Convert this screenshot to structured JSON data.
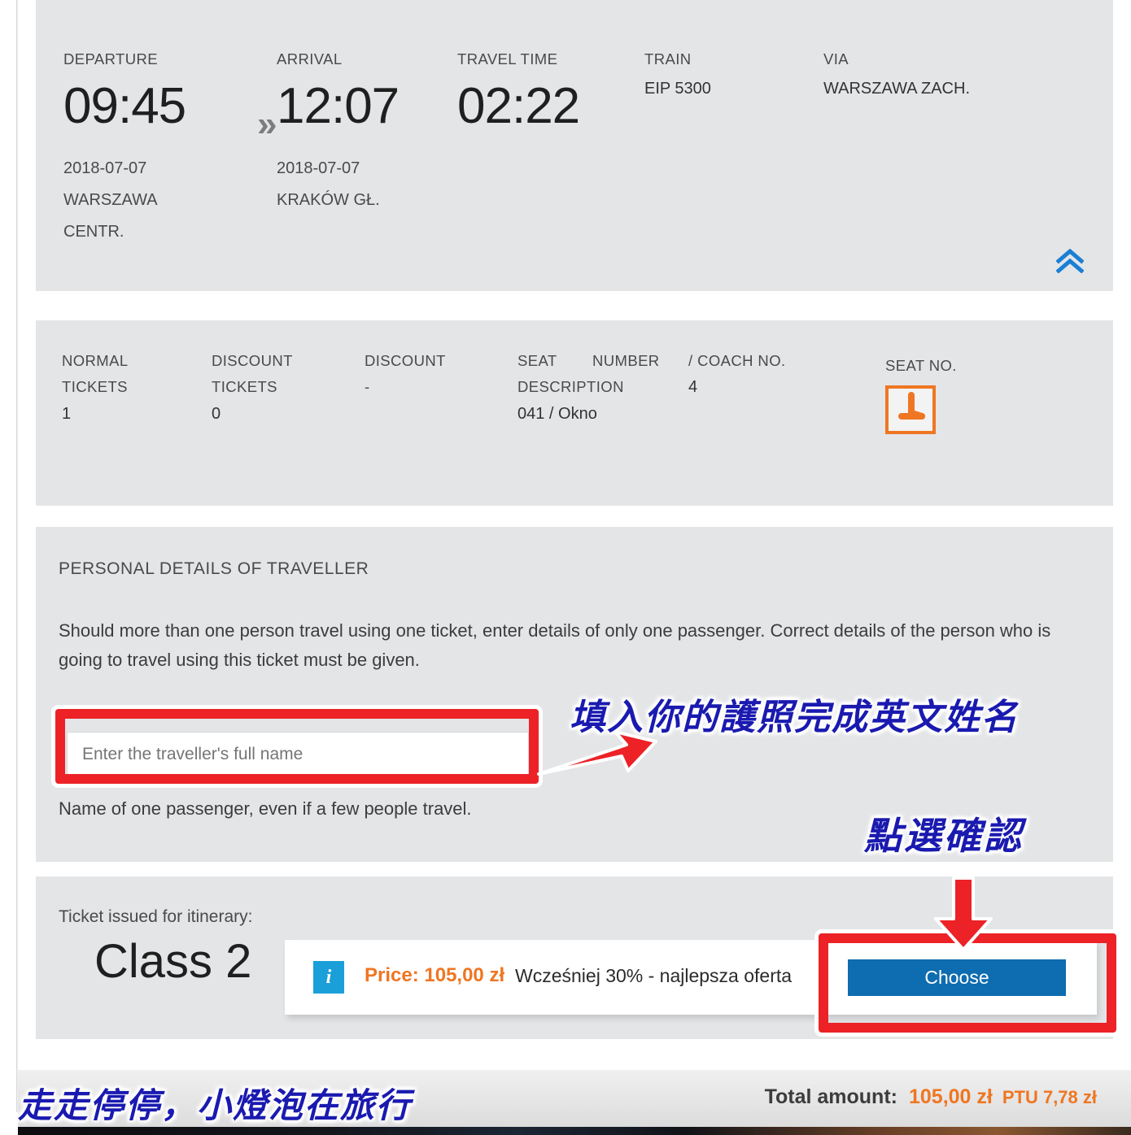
{
  "journey": {
    "labels": {
      "departure": "DEPARTURE",
      "arrival": "ARRIVAL",
      "travel_time": "TRAVEL TIME",
      "train": "TRAIN",
      "via": "VIA"
    },
    "departure_time": "09:45",
    "departure_date": "2018-07-07",
    "departure_station_line1": "WARSZAWA",
    "departure_station_line2": "CENTR.",
    "separator": "»",
    "arrival_time": "12:07",
    "arrival_date": "2018-07-07",
    "arrival_station": "KRAKÓW GŁ.",
    "travel_time": "02:22",
    "train": "EIP 5300",
    "via": "WARSZAWA ZACH.",
    "collapse_icon": "chevron-double-up-icon",
    "accent_blue": "#1a7fd4"
  },
  "tickets": {
    "normal_tickets_label_1": "NORMAL",
    "normal_tickets_label_2": "TICKETS",
    "normal_tickets_value": "1",
    "discount_tickets_label_1": "DISCOUNT",
    "discount_tickets_label_2": "TICKETS",
    "discount_tickets_value": "0",
    "discount_label": "DISCOUNT",
    "discount_value": "-",
    "seat_label_1": "SEAT",
    "seat_label_2": "DESCRIPTION",
    "seat_value": "041 / Okno",
    "number_label": "NUMBER",
    "coach_label": "/ COACH NO.",
    "coach_value": "4",
    "seat_no_label": "SEAT NO.",
    "seat_icon": "train-seat-icon",
    "seat_icon_color": "#ef7622"
  },
  "personal": {
    "title": "PERSONAL DETAILS OF TRAVELLER",
    "description": "Should more than one person travel using one ticket, enter details of only one passenger. Correct details of the person who is going to travel using this ticket must be given.",
    "name_placeholder": "Enter the traveller's full name",
    "name_value": "",
    "hint": "Name of one passenger, even if a few people travel."
  },
  "fare": {
    "issued_label": "Ticket issued for itinerary:",
    "class": "Class 2",
    "info_icon": "info-icon",
    "info_icon_glyph": "i",
    "info_icon_color": "#1b9fd8",
    "price": "Price: 105,00 zł",
    "price_color": "#ef7622",
    "offer": "Wcześniej 30% - najlepsza oferta",
    "choose_label": "Choose",
    "choose_color": "#0e6cb0"
  },
  "bottom_bar": {
    "total_label": "Total amount:",
    "total_amount": "105,00 zł",
    "total_tax": "PTU 7,78 zł",
    "amount_color": "#ef7622"
  },
  "annotations": {
    "highlight_color": "#ec2227",
    "ink_color": "#1a1ab0",
    "name_note": "填入你的護照完成英文姓名",
    "confirm_note": "點選確認",
    "watermark": "走走停停，小燈泡在旅行",
    "arrow_to_input": "arrow-right-icon",
    "arrow_to_choose": "arrow-down-icon"
  }
}
